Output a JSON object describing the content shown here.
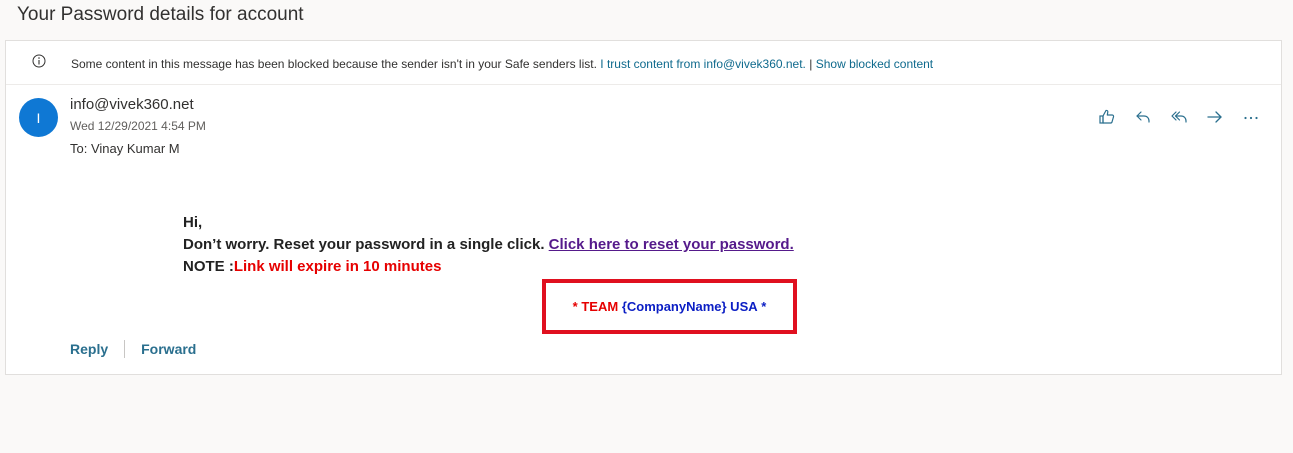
{
  "subject": "Your Password details for account",
  "infobar": {
    "message": "Some content in this message has been blocked because the sender isn't in your Safe senders list.",
    "trust_link": "I trust content from info@vivek360.net.",
    "separator": "|",
    "show_blocked": "Show blocked content"
  },
  "sender": {
    "initial": "I",
    "email": "info@vivek360.net",
    "date": "Wed 12/29/2021 4:54 PM",
    "to_label": "To:",
    "to_name": "Vinay Kumar M"
  },
  "actions": {
    "like": "like-icon",
    "reply": "reply-icon",
    "reply_all": "reply-all-icon",
    "forward": "forward-icon",
    "more": "more-icon"
  },
  "body": {
    "greeting": "Hi,",
    "line1": "Don’t worry. Reset your password in a single click.",
    "reset_link": "Click here to reset your password.",
    "note_label": "NOTE :",
    "note_text": "Link will expire in 10 minutes"
  },
  "signature": {
    "star_left": "*",
    "team": "TEAM",
    "company": "{CompanyName} USA",
    "star_right": "*"
  },
  "footer": {
    "reply": "Reply",
    "forward": "Forward"
  },
  "colors": {
    "avatar": "#0f78d4",
    "link": "#0f6a8d",
    "highlight_box": "#e0101f",
    "alert_red": "#e60000",
    "signature_blue": "#0b1ec4"
  }
}
